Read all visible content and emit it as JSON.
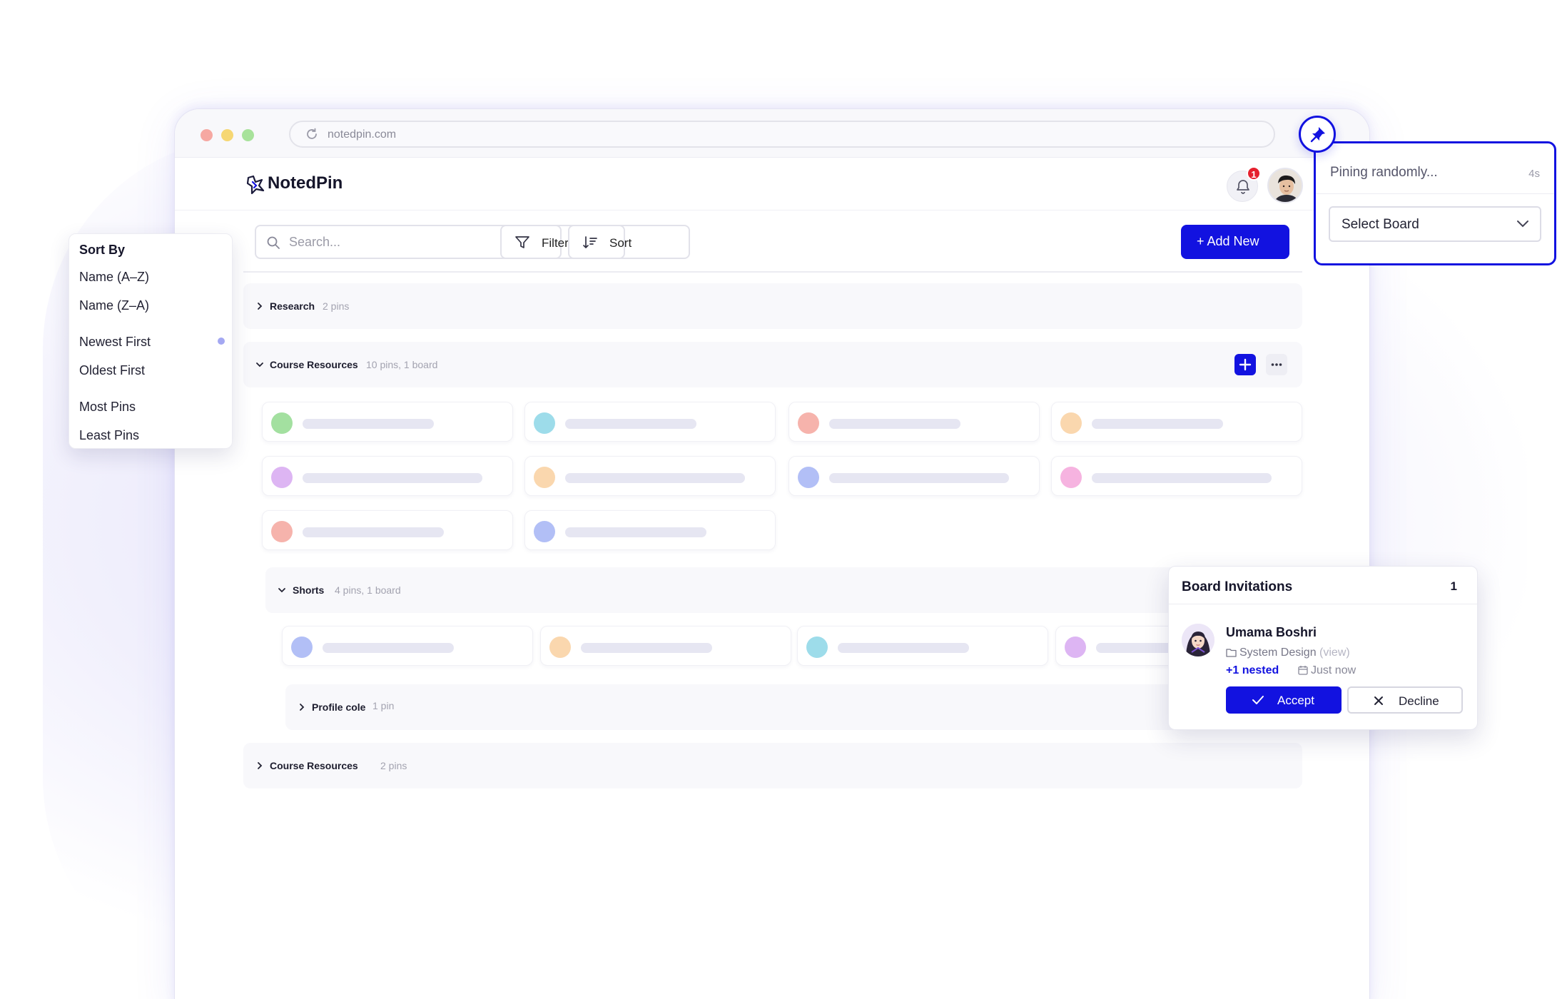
{
  "browser": {
    "url": "notedpin.com"
  },
  "app": {
    "name": "NotedPin",
    "notification_count": "1"
  },
  "toolbar": {
    "search_placeholder": "Search...",
    "filter_label": "Filter",
    "sort_label": "Sort",
    "add_new_label": "+ Add New"
  },
  "folders": {
    "research": {
      "name": "Research",
      "meta": "2 pins"
    },
    "course_resources": {
      "name": "Course Resources",
      "meta": "10 pins, 1 board"
    },
    "shorts": {
      "name": "Shorts",
      "meta": "4 pins, 1 board"
    },
    "profile_cole": {
      "name": "Profile cole",
      "meta": "1 pin"
    },
    "course_resources_2": {
      "name": "Course Resources",
      "meta": "2 pins"
    }
  },
  "pin_colors": {
    "course_resources": [
      "#a3e0a0",
      "#9ddcea",
      "#f6b3ac",
      "#fad7ae",
      "#ddb5f3",
      "#fad7ae",
      "#b2bff6",
      "#f6b3e0",
      "#f6b3ac",
      "#b2bff6"
    ],
    "shorts": [
      "#b2bff6",
      "#fad7ae",
      "#9ddcea",
      "#ddb5f3"
    ]
  },
  "sort_menu": {
    "title": "Sort By",
    "items": [
      "Name (A–Z)",
      "Name (Z–A)",
      "Newest First",
      "Oldest First",
      "Most Pins",
      "Least Pins"
    ],
    "selected": "Newest First"
  },
  "pin_panel": {
    "title": "Pining randomly...",
    "timer": "4s",
    "select_label": "Select Board"
  },
  "invitations": {
    "title": "Board Invitations",
    "count": "1",
    "sender": "Umama Boshri",
    "board": "System Design",
    "view_label": "(view)",
    "nested": "+1 nested",
    "time": "Just now",
    "accept_label": "Accept",
    "decline_label": "Decline"
  },
  "colors": {
    "accent": "#1212e0",
    "badge": "#e5202e"
  }
}
